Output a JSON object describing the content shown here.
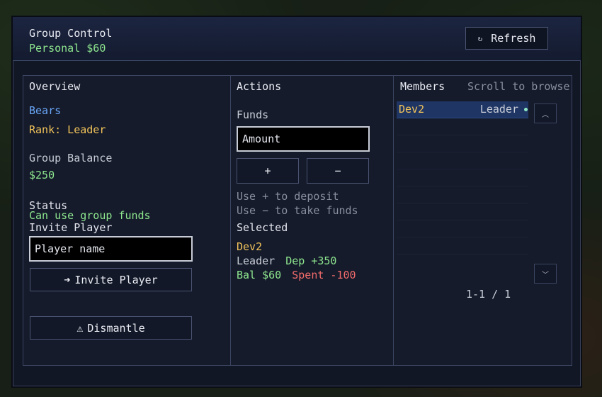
{
  "header": {
    "title": "Group Control",
    "personal": "Personal $60",
    "refresh_label": "Refresh",
    "refresh_icon": "↻"
  },
  "overview": {
    "heading": "Overview",
    "group_name": "Bears",
    "rank": "Rank: Leader",
    "balance_label": "Group Balance",
    "balance_value": "$250",
    "status_label": "Status",
    "status_value": "Can use group funds",
    "invite_label": "Invite Player",
    "invite_placeholder": "Player name",
    "invite_button": "Invite Player",
    "invite_icon": "➜",
    "dismantle_button": "Dismantle",
    "dismantle_icon": "⚠"
  },
  "actions": {
    "heading": "Actions",
    "funds_label": "Funds",
    "amount_placeholder": "Amount",
    "plus_label": "+",
    "minus_label": "−",
    "hint_deposit": "Use + to deposit",
    "hint_take": "Use − to take funds",
    "selected_label": "Selected",
    "selected": {
      "name": "Dev2",
      "role": "Leader",
      "dep": "Dep +350",
      "bal": "Bal $60",
      "spent": "Spent -100"
    }
  },
  "members": {
    "heading": "Members",
    "scroll_hint": "Scroll to browse",
    "items": [
      {
        "name": "Dev2",
        "role": "Leader"
      }
    ],
    "pagination": "1-1 / 1",
    "scroll_up_icon": "︿",
    "scroll_down_icon": "﹀"
  },
  "colors": {
    "accent_green": "#8ee68e",
    "accent_gold": "#f2c35a",
    "accent_blue": "#6aa6f8",
    "accent_red": "#f26b6b",
    "selected_row": "#1f3564"
  }
}
